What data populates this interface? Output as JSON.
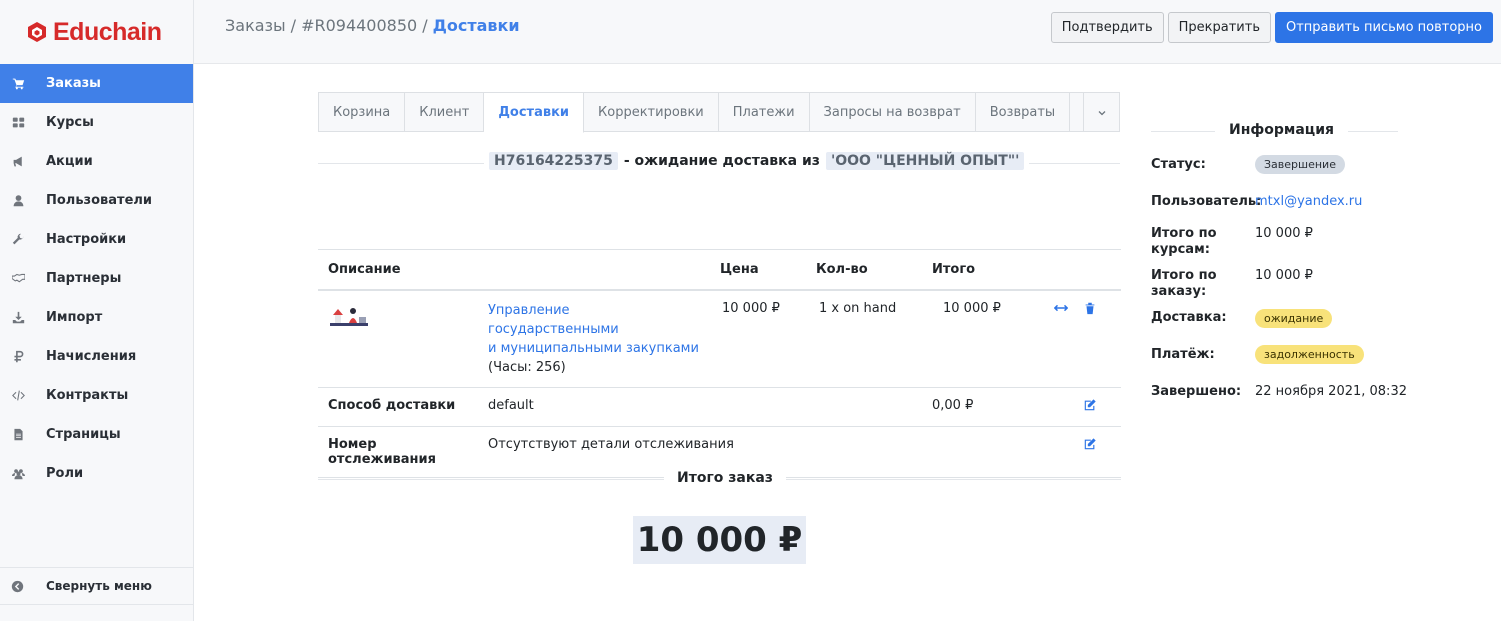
{
  "app": {
    "name": "Educhain",
    "brand_color": "#d62a2a",
    "accent": "#4080e8"
  },
  "sidebar": {
    "items": [
      {
        "label": "Заказы",
        "icon": "cart-icon",
        "active": true
      },
      {
        "label": "Курсы",
        "icon": "grid-icon"
      },
      {
        "label": "Акции",
        "icon": "megaphone-icon"
      },
      {
        "label": "Пользователи",
        "icon": "user-icon"
      },
      {
        "label": "Настройки",
        "icon": "wrench-icon"
      },
      {
        "label": "Партнеры",
        "icon": "handshake-icon"
      },
      {
        "label": "Импорт",
        "icon": "download-icon"
      },
      {
        "label": "Начисления",
        "icon": "ruble-icon"
      },
      {
        "label": "Контракты",
        "icon": "code-icon"
      },
      {
        "label": "Страницы",
        "icon": "file-icon"
      },
      {
        "label": "Роли",
        "icon": "users-icon"
      }
    ],
    "collapse_label": "Свернуть меню"
  },
  "breadcrumb": {
    "root": "Заказы",
    "order": "#R094400850",
    "current": "Доставки"
  },
  "top_buttons": {
    "confirm": "Подтвердить",
    "cancel": "Прекратить",
    "resend": "Отправить письмо повторно"
  },
  "tabs": [
    "Корзина",
    "Клиент",
    "Доставки",
    "Корректировки",
    "Платежи",
    "Запросы на возврат",
    "Возвраты"
  ],
  "shipment": {
    "number": "H76164225375",
    "status_text": "- ожидание доставка из",
    "stock_location": "'ООО \"ЦЕННЫЙ ОПЫТ\"'"
  },
  "table": {
    "headers": {
      "description": "Описание",
      "price": "Цена",
      "qty": "Кол-во",
      "total": "Итого"
    },
    "item": {
      "name_line1": "Управление государственными",
      "name_line2": "и муниципальными закупками",
      "hours": "(Часы: 256)",
      "price": "10 000 ₽",
      "qty": "1 x on hand",
      "total": "10 000 ₽"
    },
    "shipping": {
      "label": "Способ доставки",
      "value": "default",
      "cost": "0,00 ₽"
    },
    "tracking": {
      "label": "Номер отслеживания",
      "value": "Отсутствуют детали отслеживания"
    }
  },
  "order_total": {
    "label": "Итого заказ",
    "value": "10 000 ₽"
  },
  "info": {
    "title": "Информация",
    "status_label": "Статус:",
    "status": "Завершение",
    "user_label": "Пользователь:",
    "user": "mtxl@yandex.ru",
    "courses_total_label_1": "Итого по",
    "courses_total_label_2": "курсам:",
    "courses_total": "10 000 ₽",
    "order_total_label_1": "Итого по",
    "order_total_label_2": "заказу:",
    "order_total": "10 000 ₽",
    "shipment_label": "Доставка:",
    "shipment_state": "ожидание",
    "payment_label": "Платёж:",
    "payment_state": "задолженность",
    "completed_label": "Завершено:",
    "completed": "22 ноября 2021, 08:32"
  }
}
